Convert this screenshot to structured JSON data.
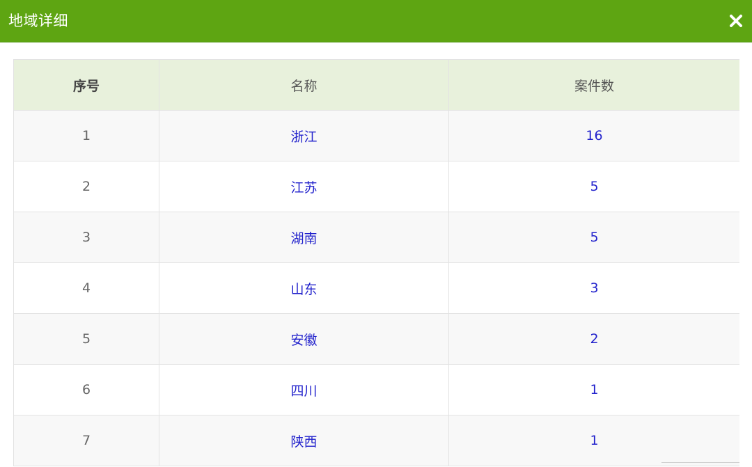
{
  "dialog": {
    "title": "地域详细",
    "close_icon": "close-icon"
  },
  "table": {
    "headers": {
      "index": "序号",
      "name": "名称",
      "count": "案件数"
    },
    "rows": [
      {
        "index": "1",
        "name": "浙江",
        "count": "16"
      },
      {
        "index": "2",
        "name": "江苏",
        "count": "5"
      },
      {
        "index": "3",
        "name": "湖南",
        "count": "5"
      },
      {
        "index": "4",
        "name": "山东",
        "count": "3"
      },
      {
        "index": "5",
        "name": "安徽",
        "count": "2"
      },
      {
        "index": "6",
        "name": "四川",
        "count": "1"
      },
      {
        "index": "7",
        "name": "陕西",
        "count": "1"
      }
    ]
  },
  "colors": {
    "header_bar": "#5ea512",
    "table_head": "#e8f1dc",
    "link": "#2222cc"
  }
}
